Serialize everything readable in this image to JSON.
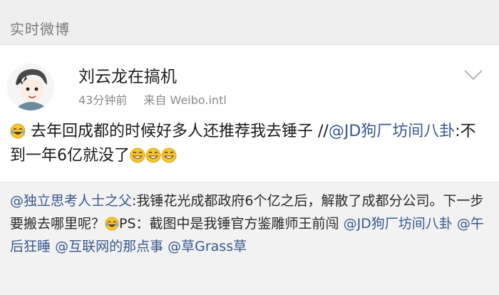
{
  "section": {
    "title": "实时微博"
  },
  "post": {
    "author": "刘云龙在搞机",
    "time": "43分钟前",
    "source": "来自 Weibo.intl",
    "text_1": "去年回成都的时候好多人还推荐我去锤子 //",
    "mention": "@JD狗厂坊间八卦",
    "text_2": ":不到一年6亿就没了",
    "emoji": [
      "laugh-cry-emoji",
      "grin-emoji",
      "grin-emoji",
      "grin-emoji"
    ]
  },
  "repost": {
    "author_mention": "@独立思考人士之父",
    "text_1": ":我锤花光成都政府6个亿之后，解散了成都分公司。下一步要搬去哪里呢？",
    "text_2": "PS：截图中是我锤官方鉴雕师王前闯 ",
    "mentions": [
      "@JD狗厂坊间八卦",
      "@午后狂睡",
      "@互联网的那点事",
      "@草Grass草"
    ]
  },
  "colors": {
    "link": "#39598e",
    "header_text": "#7a7a7a",
    "meta_text": "#8a8a8a"
  }
}
